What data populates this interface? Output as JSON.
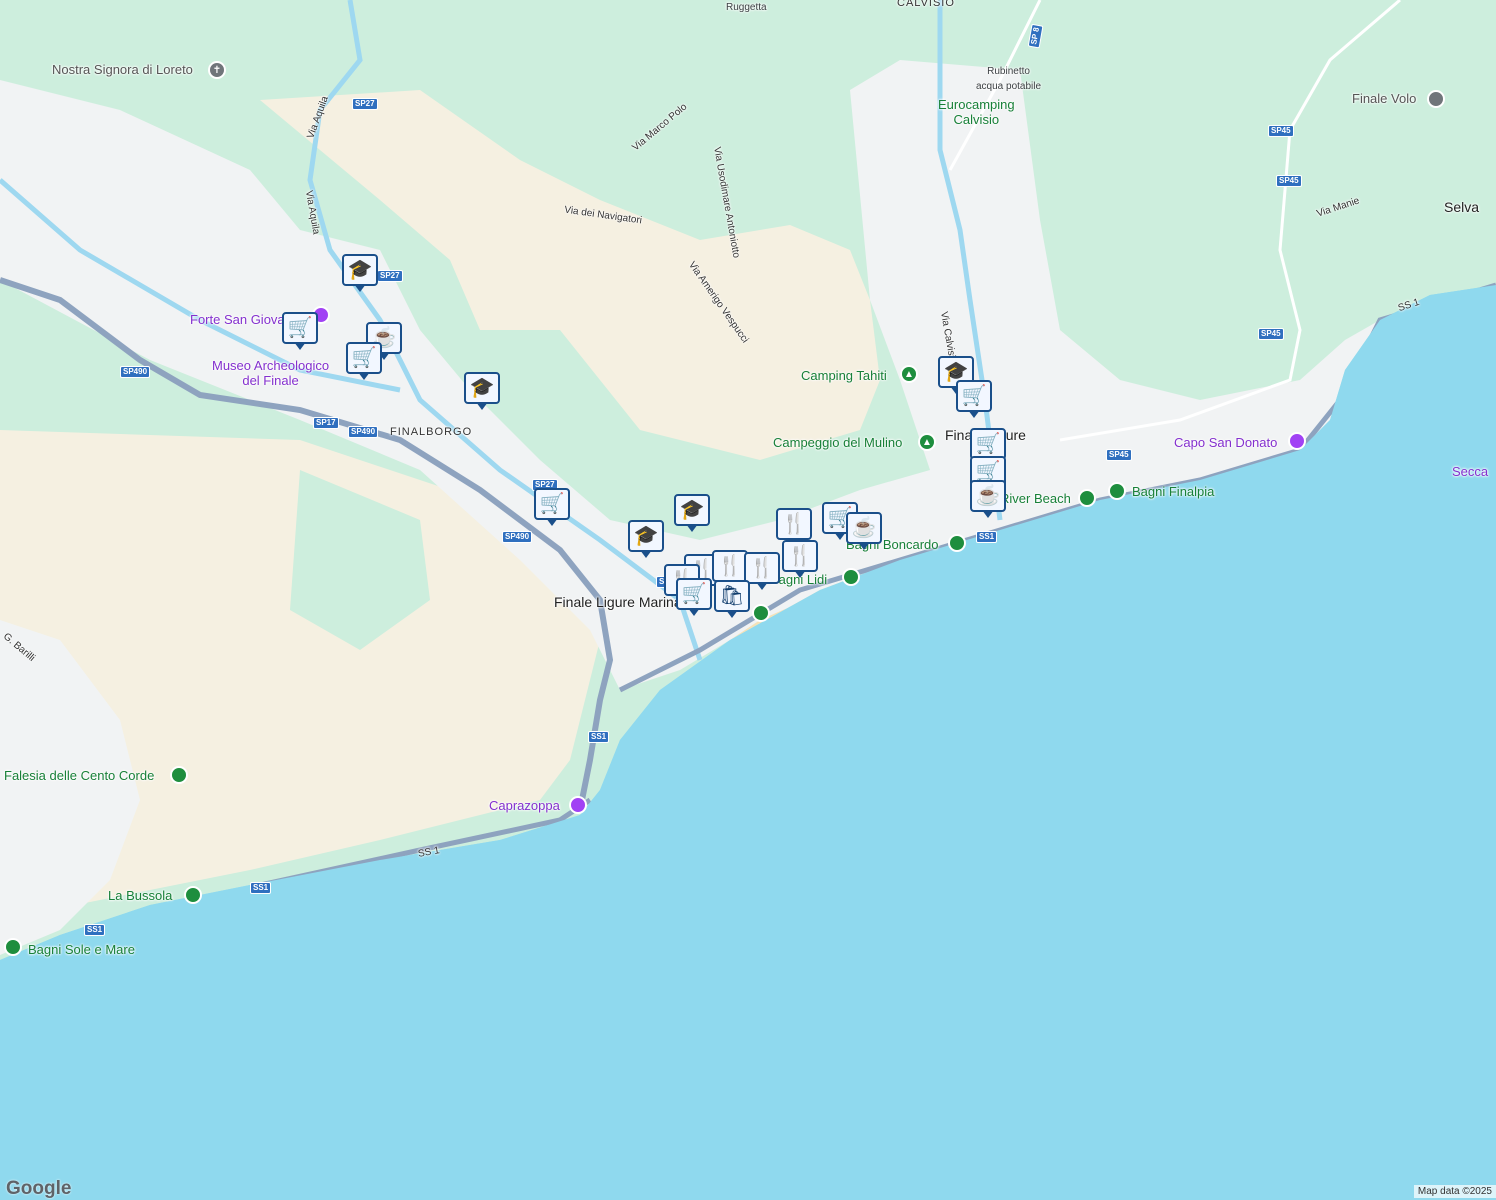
{
  "map": {
    "colors": {
      "sea": "#8fd9ee",
      "forest": "#cdeedd",
      "urban": "#f1f3f4",
      "sand": "#f5f0e1",
      "road_major": "#8ea3bf",
      "poi_marker": "#1a4f8a"
    },
    "places": [
      {
        "id": "ruggetta",
        "text": "Ruggetta",
        "kind": "small"
      },
      {
        "id": "calvisio",
        "text": "CALVISIO",
        "kind": "upper"
      },
      {
        "id": "rubinetto",
        "text": "Rubinetto\nacqua potabile",
        "kind": "small"
      },
      {
        "id": "eurocamping",
        "text": "Eurocamping\nCalvisio",
        "kind": "poi-green"
      },
      {
        "id": "finale-volo",
        "text": "Finale Volo",
        "kind": "poi-gray"
      },
      {
        "id": "selva",
        "text": "Selva",
        "kind": "town"
      },
      {
        "id": "nostra-signora",
        "text": "Nostra Signora di Loreto",
        "kind": "poi-gray"
      },
      {
        "id": "via-marco-polo",
        "text": "Via Marco Polo",
        "kind": "road"
      },
      {
        "id": "via-usodimare",
        "text": "Via Usodimare Antoniotto",
        "kind": "road"
      },
      {
        "id": "via-navigatori",
        "text": "Via dei Navigatori",
        "kind": "road"
      },
      {
        "id": "via-vespucci",
        "text": "Via Amerigo Vespucci",
        "kind": "road"
      },
      {
        "id": "via-aquila-1",
        "text": "Via Aquila",
        "kind": "road"
      },
      {
        "id": "via-aquila-2",
        "text": "Via Aquila",
        "kind": "road"
      },
      {
        "id": "via-manie",
        "text": "Via Manie",
        "kind": "road"
      },
      {
        "id": "via-calvisio",
        "text": "Via Calvisio",
        "kind": "road"
      },
      {
        "id": "forte",
        "text": "Forte San Giovanni",
        "kind": "poi-purple"
      },
      {
        "id": "museo",
        "text": "Museo Archeologico\ndel Finale",
        "kind": "poi-purple"
      },
      {
        "id": "finalborgo",
        "text": "FINALBORGO",
        "kind": "upper"
      },
      {
        "id": "camping-tahiti",
        "text": "Camping Tahiti",
        "kind": "poi-green"
      },
      {
        "id": "campeggio-mulino",
        "text": "Campeggio del Mulino",
        "kind": "poi-green"
      },
      {
        "id": "finale-ligure",
        "text": "Finale Ligure",
        "kind": "town"
      },
      {
        "id": "capo-san-donato",
        "text": "Capo San Donato",
        "kind": "poi-purple"
      },
      {
        "id": "secca",
        "text": "Secca",
        "kind": "poi-purple"
      },
      {
        "id": "river-beach",
        "text": "River Beach",
        "kind": "poi-green"
      },
      {
        "id": "bagni-finalpia",
        "text": "Bagni Finalpia",
        "kind": "poi-green"
      },
      {
        "id": "bagni-boncardo",
        "text": "Bagni Boncardo",
        "kind": "poi-green"
      },
      {
        "id": "bagni-lidi",
        "text": "Bagni Lidi",
        "kind": "poi-green"
      },
      {
        "id": "finale-ligure-marina",
        "text": "Finale Ligure Marina",
        "kind": "town"
      },
      {
        "id": "g-barilli",
        "text": "G. Barilli",
        "kind": "road"
      },
      {
        "id": "falesia",
        "text": "Falesia delle Cento Corde",
        "kind": "poi-green"
      },
      {
        "id": "caprazoppa",
        "text": "Caprazoppa",
        "kind": "poi-purple"
      },
      {
        "id": "la-bussola",
        "text": "La Bussola",
        "kind": "poi-green"
      },
      {
        "id": "bagni-sole",
        "text": "Bagni Sole e Mare",
        "kind": "poi-green"
      },
      {
        "id": "ss1-sea",
        "text": "SS 1",
        "kind": "road"
      },
      {
        "id": "ss1-ne",
        "text": "SS 1",
        "kind": "road"
      }
    ],
    "shields": [
      "SP27",
      "SP27",
      "SP27",
      "SP490",
      "SP490",
      "SP490",
      "SP17",
      "SS1",
      "SS1",
      "SS1",
      "SS1",
      "SS1",
      "SP45",
      "SP45",
      "SP45",
      "SP45",
      "SP 8"
    ],
    "markers": [
      {
        "type": "school",
        "glyph": "🎓"
      },
      {
        "type": "grocery",
        "glyph": "🛒"
      },
      {
        "type": "cafe",
        "glyph": "☕"
      },
      {
        "type": "grocery",
        "glyph": "🛒"
      },
      {
        "type": "school",
        "glyph": "🎓"
      },
      {
        "type": "grocery",
        "glyph": "🛒"
      },
      {
        "type": "school",
        "glyph": "🎓"
      },
      {
        "type": "school",
        "glyph": "🎓"
      },
      {
        "type": "restaurant",
        "glyph": "🍴"
      },
      {
        "type": "grocery",
        "glyph": "🛒"
      },
      {
        "type": "cafe",
        "glyph": "☕"
      },
      {
        "type": "restaurant",
        "glyph": "🍴"
      },
      {
        "type": "restaurant",
        "glyph": "🍴"
      },
      {
        "type": "restaurant",
        "glyph": "🍴"
      },
      {
        "type": "restaurant",
        "glyph": "🍴"
      },
      {
        "type": "restaurant",
        "glyph": "🍴"
      },
      {
        "type": "grocery",
        "glyph": "🛒"
      },
      {
        "type": "shopping",
        "glyph": "🛍"
      },
      {
        "type": "school",
        "glyph": "🎓"
      },
      {
        "type": "grocery",
        "glyph": "🛒"
      },
      {
        "type": "grocery",
        "glyph": "🛒"
      },
      {
        "type": "grocery",
        "glyph": "🛒"
      },
      {
        "type": "cafe",
        "glyph": "☕"
      }
    ],
    "brand": "Google",
    "attribution": "Map data ©2025"
  }
}
